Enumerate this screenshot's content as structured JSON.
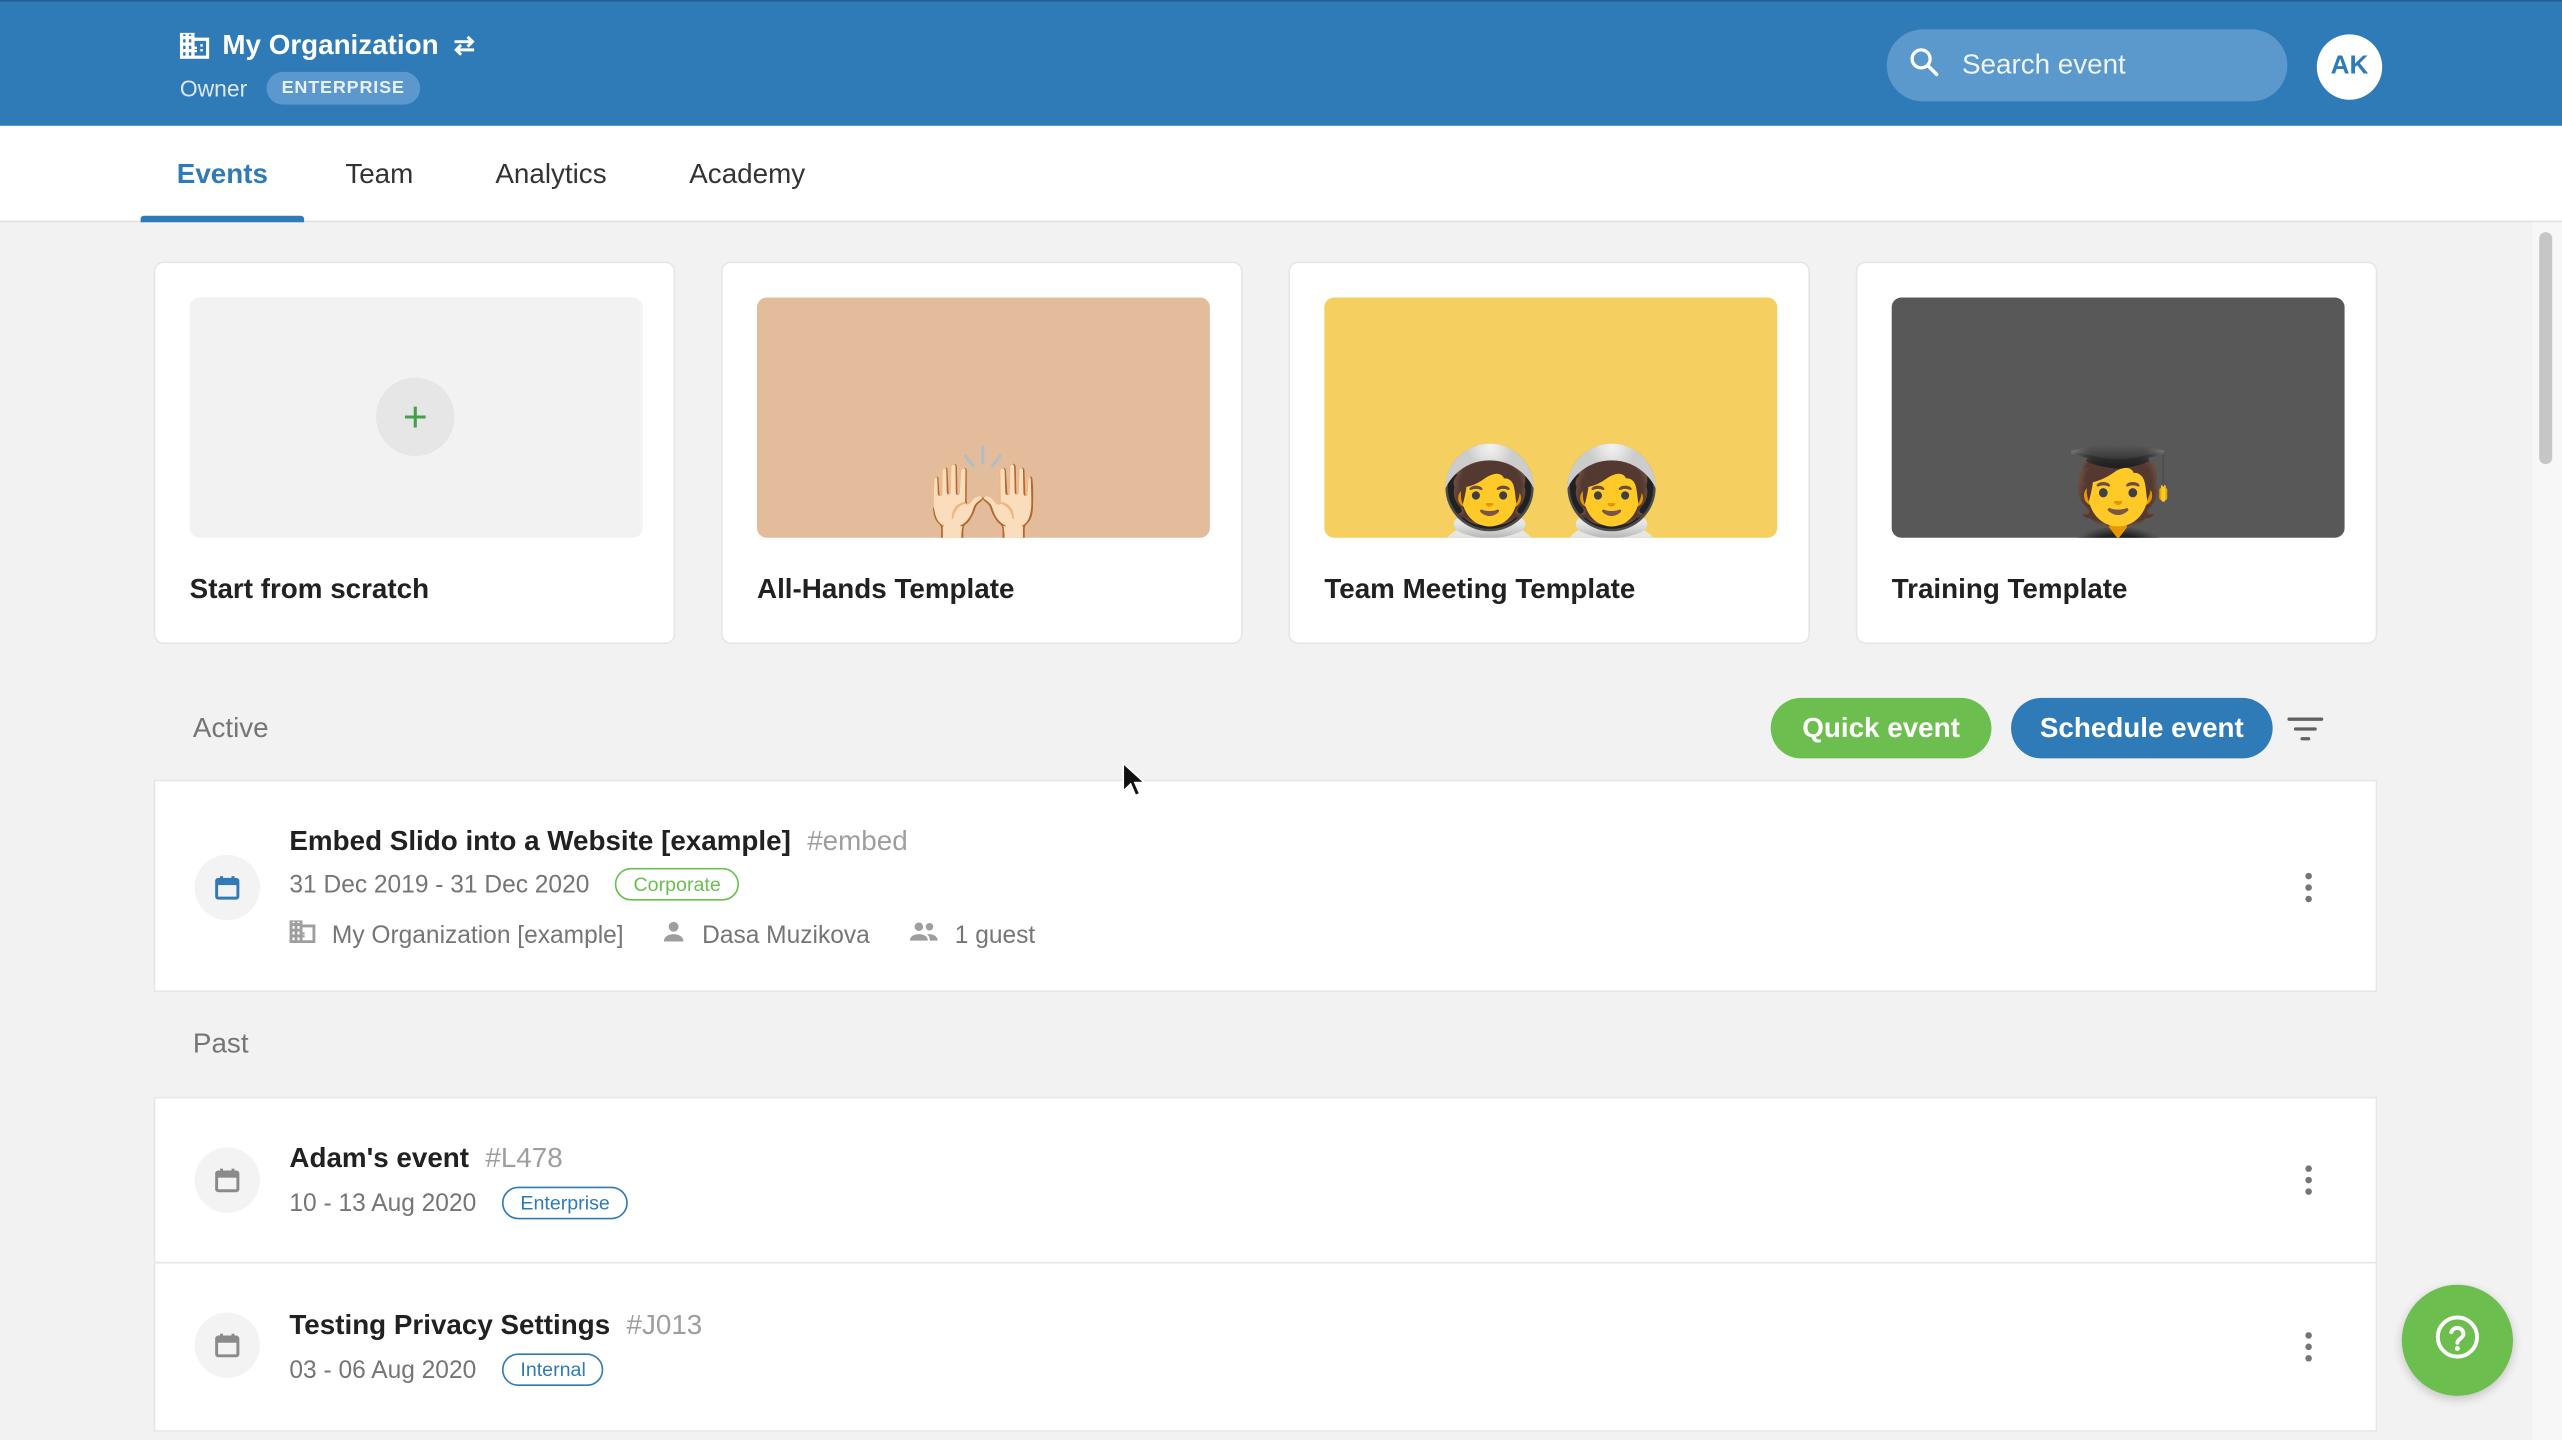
{
  "header": {
    "org_name": "My Organization",
    "role": "Owner",
    "plan_badge": "ENTERPRISE",
    "search_placeholder": "Search event",
    "avatar_initials": "AK",
    "brand_color": "#2f7bb8"
  },
  "tabs": [
    {
      "label": "Events",
      "active": true
    },
    {
      "label": "Team",
      "active": false
    },
    {
      "label": "Analytics",
      "active": false
    },
    {
      "label": "Academy",
      "active": false
    }
  ],
  "templates": [
    {
      "label": "Start from scratch",
      "icon": "plus-icon",
      "bg": "#f2f2f2"
    },
    {
      "label": "All-Hands Template",
      "icon": "raising-hands-emoji",
      "emoji": "🙌🏻",
      "bg": "#e3bc9b"
    },
    {
      "label": "Team Meeting Template",
      "icon": "astronauts-emoji",
      "emoji": "🧑‍🚀🧑‍🚀",
      "bg": "#f5cf5f"
    },
    {
      "label": "Training Template",
      "icon": "student-emoji",
      "emoji": "🧑‍🎓",
      "bg": "#585858"
    }
  ],
  "active_section": {
    "label": "Active",
    "quick_event_label": "Quick event",
    "schedule_event_label": "Schedule event",
    "events": [
      {
        "title": "Embed Slido into a Website [example]",
        "code": "#embed",
        "dates": "31 Dec 2019 - 31 Dec 2020",
        "tag": "Corporate",
        "organization": "My Organization [example]",
        "owner": "Dasa Muzikova",
        "guests": "1 guest"
      }
    ]
  },
  "past_section": {
    "label": "Past",
    "events": [
      {
        "title": "Adam's event",
        "code": "#L478",
        "dates": "10 - 13 Aug 2020",
        "tag": "Enterprise"
      },
      {
        "title": "Testing Privacy Settings",
        "code": "#J013",
        "dates": "03 - 06 Aug 2020",
        "tag": "Internal"
      }
    ]
  },
  "colors": {
    "green": "#6cbf4f",
    "blue": "#2f7bb8"
  }
}
